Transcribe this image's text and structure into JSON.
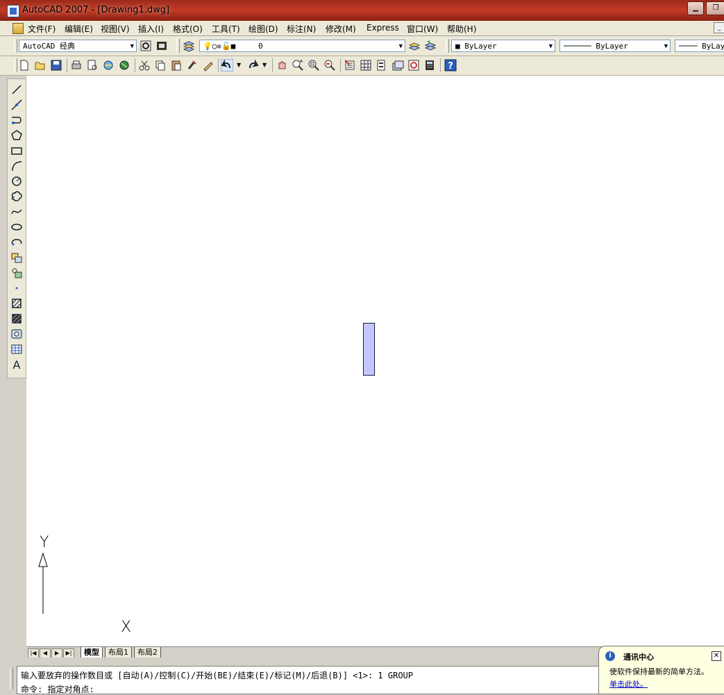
{
  "window": {
    "title": "AutoCAD 2007 - [Drawing1.dwg]"
  },
  "menu": [
    "文件(F)",
    "编辑(E)",
    "视图(V)",
    "插入(I)",
    "格式(O)",
    "工具(T)",
    "绘图(D)",
    "标注(N)",
    "修改(M)",
    "Express",
    "窗口(W)",
    "帮助(H)"
  ],
  "toolbar1": {
    "workspace": "AutoCAD 经典",
    "layer": "0",
    "color": "ByLayer",
    "linetype": "ByLayer",
    "lineweight": "ByLay"
  },
  "ucs": {
    "x_label": "X",
    "y_label": "Y"
  },
  "layout_tabs": [
    "模型",
    "布局1",
    "布局2"
  ],
  "command": {
    "line1": "输入要放弃的操作数目或 [自动(A)/控制(C)/开始(BE)/结束(E)/标记(M)/后退(B)] <1>: 1 GROUP",
    "line2": "命令: 指定对角点:"
  },
  "balloon": {
    "title": "通讯中心",
    "body": "使软件保持最新的简单方法。",
    "link": "单击此处。"
  },
  "colors": {
    "object_fill": "#c6c6ff",
    "canvas": "#ffffff",
    "title_bar": "#c23a25"
  }
}
